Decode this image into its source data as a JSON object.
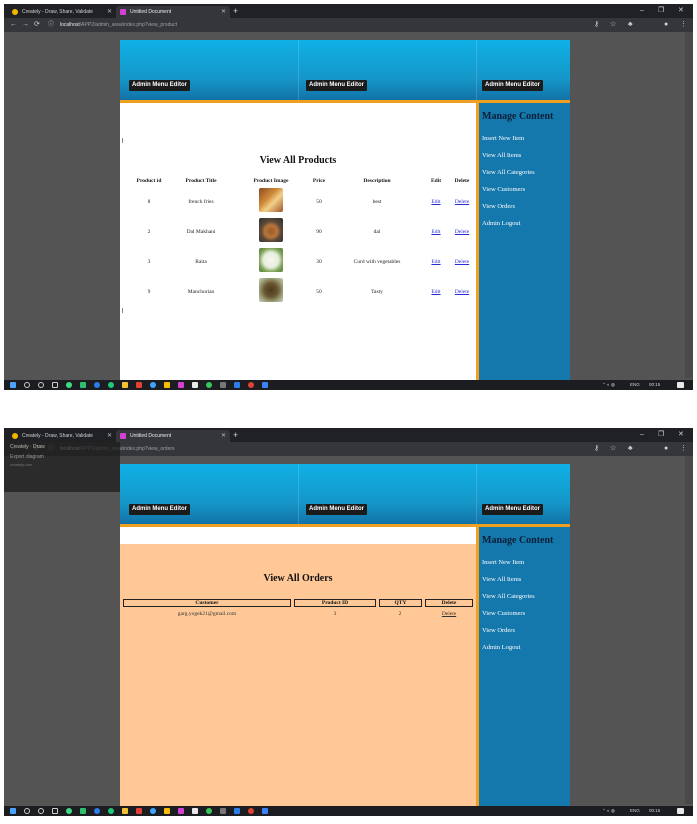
{
  "browser": {
    "tabs": [
      {
        "title": "Creately - Draw, Share, Validate"
      },
      {
        "title": "Untitled Document"
      }
    ],
    "new_tab": "+",
    "controls": {
      "minimize": "–",
      "restore": "❐",
      "close": "✕"
    }
  },
  "shot1": {
    "url_host": "localhost",
    "url_path": "/APP2/admin_area/index.php?view_product",
    "header_buttons": [
      "Admin Menu Editor",
      "Admin Menu Editor",
      "Admin Menu Editor"
    ],
    "sidebar": {
      "title": "Manage Content",
      "items": [
        "Insert New Item",
        "View All Items",
        "View All Categories",
        "View Customers",
        "View Orders",
        "Admin Logout"
      ]
    },
    "page_title": "View All Products",
    "columns": [
      "Product id",
      "Product Title",
      "Product Image",
      "Price",
      "Description",
      "Edit",
      "Delete"
    ],
    "rows": [
      {
        "id": "8",
        "title": "french fries",
        "price": "50",
        "desc": "best",
        "edit": "Edit",
        "delete": "Delete",
        "image": "fries-photo"
      },
      {
        "id": "2",
        "title": "Dal Makhani",
        "price": "90",
        "desc": "dal",
        "edit": "Edit",
        "delete": "Delete",
        "image": "dal-photo"
      },
      {
        "id": "3",
        "title": "Raita",
        "price": "30",
        "desc": "Curd with vegetables",
        "edit": "Edit",
        "delete": "Delete",
        "image": "raita-photo"
      },
      {
        "id": "9",
        "title": "Manchurian",
        "price": "50",
        "desc": "Tasty",
        "edit": "Edit",
        "delete": "Delete",
        "image": "manchurian-photo"
      }
    ],
    "taskbar": {
      "lang": "ENG",
      "time": "00:15"
    }
  },
  "shot2": {
    "url_host": "localhost",
    "url_path": "/APP2/admin_area/index.php?view_orders",
    "overlay": {
      "line1": "Creately · Draw",
      "line2": "Export diagram",
      "line3": "creately.com"
    },
    "header_buttons": [
      "Admin Menu Editor",
      "Admin Menu Editor",
      "Admin Menu Editor"
    ],
    "sidebar": {
      "title": "Manage Content",
      "items": [
        "Insert New Item",
        "View All Items",
        "View All Categories",
        "View Customers",
        "View Orders",
        "Admin Logout"
      ]
    },
    "page_title": "View All Orders",
    "columns": [
      "Customer",
      "Product ID",
      "QTY",
      "Delete"
    ],
    "row": {
      "customer": "garg.yogek21@gmail.com",
      "product_id": "3",
      "qty": "2",
      "delete": "Delete"
    },
    "taskbar": {
      "lang": "ENG",
      "time": "00:16"
    }
  },
  "colors": {
    "header_blue": "#1596c8",
    "sidebar_blue": "#1478ad",
    "orange": "#f0a020",
    "orders_bg": "#ffc896"
  }
}
